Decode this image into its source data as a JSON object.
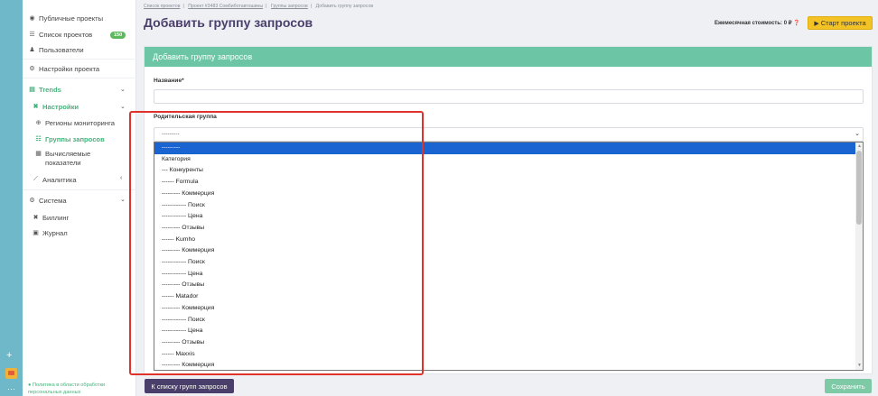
{
  "sidebar": {
    "items": [
      {
        "icon": "eye-icon",
        "glyph": "◉",
        "label": "Публичные проекты"
      },
      {
        "icon": "list-icon",
        "glyph": "☰",
        "label": "Список проектов",
        "badge": "150"
      },
      {
        "icon": "users-icon",
        "glyph": "♟",
        "label": "Пользователи"
      },
      {
        "icon": "gears-icon",
        "glyph": "⚙",
        "label": "Настройки проекта"
      },
      {
        "icon": "table-icon",
        "glyph": "▤",
        "label": "Trends"
      },
      {
        "icon": "tools-icon",
        "glyph": "✖",
        "label": "Настройки"
      },
      {
        "icon": "globe-icon",
        "glyph": "⊕",
        "label": "Регионы мониторинга"
      },
      {
        "icon": "group-icon",
        "glyph": "☷",
        "label": "Группы запросов"
      },
      {
        "icon": "calculator-icon",
        "glyph": "▦",
        "label": "Вычисляемые показатели"
      },
      {
        "icon": "chart-line-icon",
        "glyph": "⟋",
        "label": "Аналитика"
      },
      {
        "icon": "gears-icon",
        "glyph": "⚙",
        "label": "Система"
      },
      {
        "icon": "tools-icon",
        "glyph": "✖",
        "label": "Биллинг"
      },
      {
        "icon": "book-icon",
        "glyph": "▣",
        "label": "Журнал"
      }
    ],
    "policy": "Политика в области обработки персональных данных"
  },
  "breadcrumbs": [
    "Список проектов",
    "Проект #3483 Сомбиботавтошины",
    "Группы запросов",
    "Добавить группу запросов"
  ],
  "page_title": "Добавить группу запросов",
  "header": {
    "cost_label": "Ежемесячная стоимость: 0 ₽",
    "start_button": "Старт проекта"
  },
  "form": {
    "card_title": "Добавить группу запросов",
    "name_label": "Название*",
    "name_value": "",
    "parent_label": "Родительская группа",
    "parent_value": "---------"
  },
  "dropdown": {
    "options": [
      "---------",
      "Категория",
      "--- Конкуренты",
      "------ Formula",
      "--------- Коммерция",
      "------------ Поиск",
      "------------ Цена",
      "--------- Отзывы",
      "------ Kumho",
      "--------- Коммерция",
      "------------ Поиск",
      "------------ Цена",
      "--------- Отзывы",
      "------ Matador",
      "--------- Коммерция",
      "------------ Поиск",
      "------------ Цена",
      "--------- Отзывы",
      "------ Maxxis",
      "--------- Коммерция"
    ],
    "selected_index": 0
  },
  "footer": {
    "back_button": "К списку групп запросов",
    "save_button": "Сохранить"
  },
  "colors": {
    "accent_green": "#44b37c",
    "header_green": "#6cc6a6",
    "purple": "#4a3f6b",
    "start_yellow": "#f3c224",
    "selection_blue": "#1a64d1",
    "annotation_red": "#e0312b"
  }
}
